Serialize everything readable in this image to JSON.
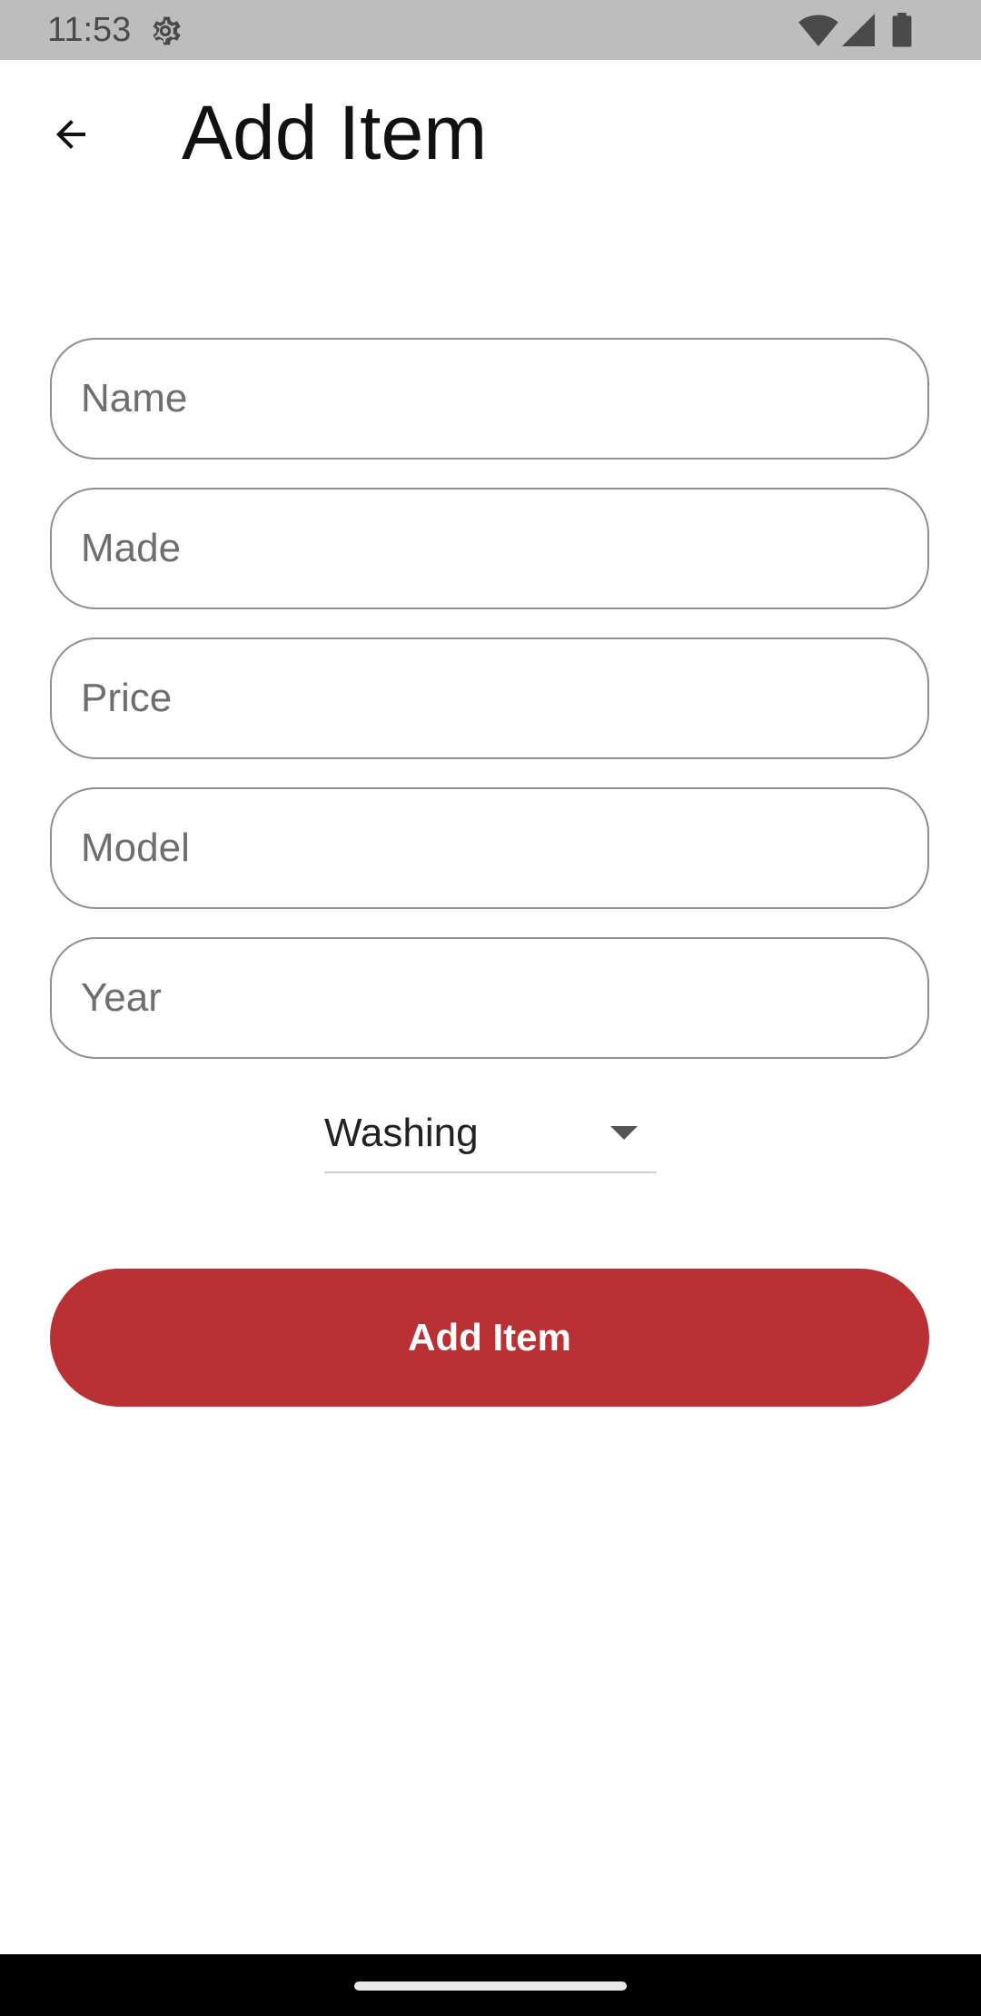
{
  "status_bar": {
    "time": "11:53",
    "icons": [
      "gear-icon",
      "wifi-icon",
      "signal-icon",
      "battery-icon"
    ]
  },
  "app_bar": {
    "back_icon": "arrow-back-icon",
    "title": "Add Item"
  },
  "form": {
    "fields": [
      {
        "name": "name",
        "value": "",
        "placeholder": "Name"
      },
      {
        "name": "made",
        "value": "",
        "placeholder": "Made"
      },
      {
        "name": "price",
        "value": "",
        "placeholder": "Price"
      },
      {
        "name": "model",
        "value": "",
        "placeholder": "Model"
      },
      {
        "name": "year",
        "value": "",
        "placeholder": "Year"
      }
    ],
    "category": {
      "selected": "Washing",
      "icon": "dropdown-arrow-icon"
    },
    "submit_label": "Add Item"
  },
  "colors": {
    "status_bar_bg": "#bdbdbd",
    "primary": "#b93135",
    "field_border": "#8e8e8e",
    "nav_bar_bg": "#000000"
  }
}
